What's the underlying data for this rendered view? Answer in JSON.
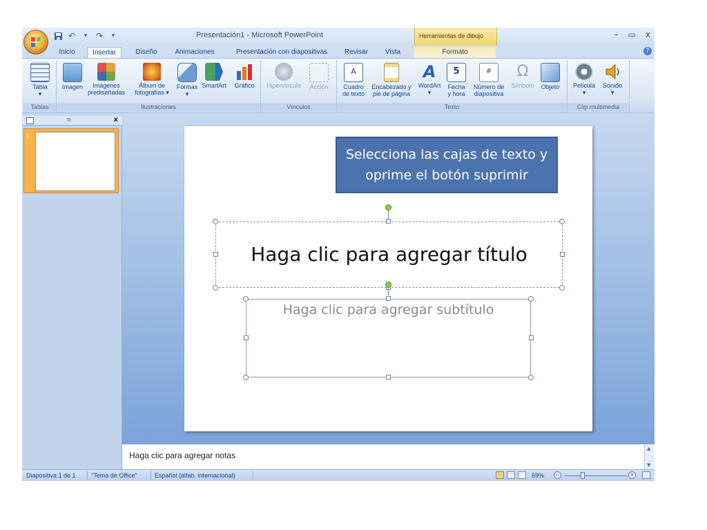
{
  "window": {
    "title": "Presentación1 - Microsoft PowerPoint",
    "contextual_group": "Herramientas de dibujo",
    "controls": {
      "minimize": "–",
      "restore": "▭",
      "close": "x"
    },
    "help": "?"
  },
  "tabs": [
    {
      "label": "Inicio"
    },
    {
      "label": "Insertar"
    },
    {
      "label": "Diseño"
    },
    {
      "label": "Animaciones"
    },
    {
      "label": "Presentación con diapositivas"
    },
    {
      "label": "Revisar"
    },
    {
      "label": "Vista"
    },
    {
      "label": "Formato"
    }
  ],
  "active_tab": "Insertar",
  "ribbon": {
    "groups": {
      "tablas": "Tablas",
      "ilustraciones": "Ilustraciones",
      "vinculos": "Vínculos",
      "texto": "Texto",
      "clip": "Clip multimedia"
    },
    "buttons": {
      "tabla": {
        "line1": "Tabla",
        "line2": "▾"
      },
      "imagen": {
        "line1": "Imagen",
        "line2": ""
      },
      "imagenes": {
        "line1": "Imágenes",
        "line2": "prediseñadas"
      },
      "album": {
        "line1": "Álbum de",
        "line2": "fotografías ▾"
      },
      "formas": {
        "line1": "Formas",
        "line2": "▾"
      },
      "smartart": {
        "line1": "SmartArt",
        "line2": ""
      },
      "grafico": {
        "line1": "Gráfico",
        "line2": ""
      },
      "hipervinculo": {
        "line1": "Hipervínculo",
        "line2": ""
      },
      "accion": {
        "line1": "Acción",
        "line2": ""
      },
      "cuadro": {
        "line1": "Cuadro",
        "line2": "de texto"
      },
      "encabezado": {
        "line1": "Encabezado y",
        "line2": "pie de página"
      },
      "wordart": {
        "line1": "WordArt",
        "line2": "▾"
      },
      "fecha": {
        "line1": "Fecha",
        "line2": "y hora"
      },
      "numero": {
        "line1": "Número de",
        "line2": "diapositiva"
      },
      "simbolo": {
        "line1": "Símbolo",
        "line2": ""
      },
      "objeto": {
        "line1": "Objeto",
        "line2": ""
      },
      "pelicula": {
        "line1": "Película",
        "line2": "▾"
      },
      "sonido": {
        "line1": "Sonido",
        "line2": "▾"
      }
    }
  },
  "slides_pane": {
    "thumb_number": "1",
    "close": "x"
  },
  "slide": {
    "callout": "Selecciona las cajas de texto y oprime el botón suprimir",
    "title_placeholder": "Haga clic para agregar título",
    "subtitle_placeholder": "Haga clic para agregar subtítulo"
  },
  "notes": {
    "placeholder": "Haga clic para agregar notas"
  },
  "status": {
    "slide_info": "Diapositiva 1 de 1",
    "theme": "\"Tema de Office\"",
    "language": "Español (alfab. internacional)",
    "zoom": "69%"
  },
  "colors": {
    "ribbon_bg": "#dbe7f6",
    "callout_bg": "#4b73ad",
    "rotation_handle": "#85d03e",
    "thumb_highlight": "#f7b44a"
  }
}
